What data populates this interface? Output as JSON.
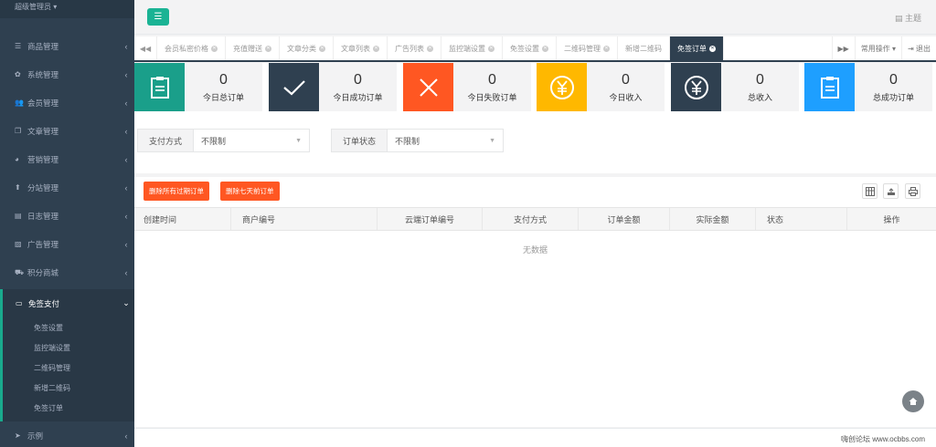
{
  "sidebar": {
    "user": "超级管理员",
    "items": [
      {
        "label": "商品管理",
        "icon": "list-icon"
      },
      {
        "label": "系统管理",
        "icon": "gear-icon"
      },
      {
        "label": "会员管理",
        "icon": "users-icon"
      },
      {
        "label": "文章管理",
        "icon": "copy-icon"
      },
      {
        "label": "营销管理",
        "icon": "pie-icon"
      },
      {
        "label": "分站管理",
        "icon": "upload-icon"
      },
      {
        "label": "日志管理",
        "icon": "log-icon"
      },
      {
        "label": "广告管理",
        "icon": "image-icon"
      },
      {
        "label": "积分商城",
        "icon": "cart-icon"
      }
    ],
    "active": {
      "label": "免签支付",
      "icon": "card-icon",
      "children": [
        "免签设置",
        "监控端设置",
        "二维码管理",
        "新增二维码",
        "免签订单"
      ]
    },
    "last": {
      "label": "示例",
      "icon": "send-icon"
    }
  },
  "topbar": {
    "theme_label": "主题"
  },
  "tabs": {
    "items": [
      "会员私密价格",
      "充值赠送",
      "文章分类",
      "文章列表",
      "广告列表",
      "监控端设置",
      "免签设置",
      "二维码管理",
      "新增二维码",
      "免签订单"
    ],
    "active_index": 9,
    "ops_label": "常用操作",
    "logout_label": "退出"
  },
  "stats": [
    {
      "value": "0",
      "caption": "今日总订单",
      "color": "#1a9f8a",
      "icon": "clipboard-icon"
    },
    {
      "value": "0",
      "caption": "今日成功订单",
      "color": "#2f4050",
      "icon": "check-icon"
    },
    {
      "value": "0",
      "caption": "今日失败订单",
      "color": "#ff5722",
      "icon": "cross-icon"
    },
    {
      "value": "0",
      "caption": "今日收入",
      "color": "#ffb800",
      "icon": "yen-icon"
    },
    {
      "value": "0",
      "caption": "总收入",
      "color": "#2f4050",
      "icon": "yen-icon"
    },
    {
      "value": "0",
      "caption": "总成功订单",
      "color": "#1e9fff",
      "icon": "clipboard-icon"
    }
  ],
  "filters": [
    {
      "label": "支付方式",
      "value": "不限制"
    },
    {
      "label": "订单状态",
      "value": "不限制"
    }
  ],
  "actions": {
    "delete_expired": "删除所有过期订单",
    "delete_week": "删除七天前订单"
  },
  "table": {
    "columns": [
      "创建时间",
      "商户编号",
      "云端订单编号",
      "支付方式",
      "订单金额",
      "实际金额",
      "状态",
      "操作"
    ],
    "empty_text": "无数据"
  },
  "footer": {
    "text": "嗨创论坛 www.ocbbs.com"
  }
}
